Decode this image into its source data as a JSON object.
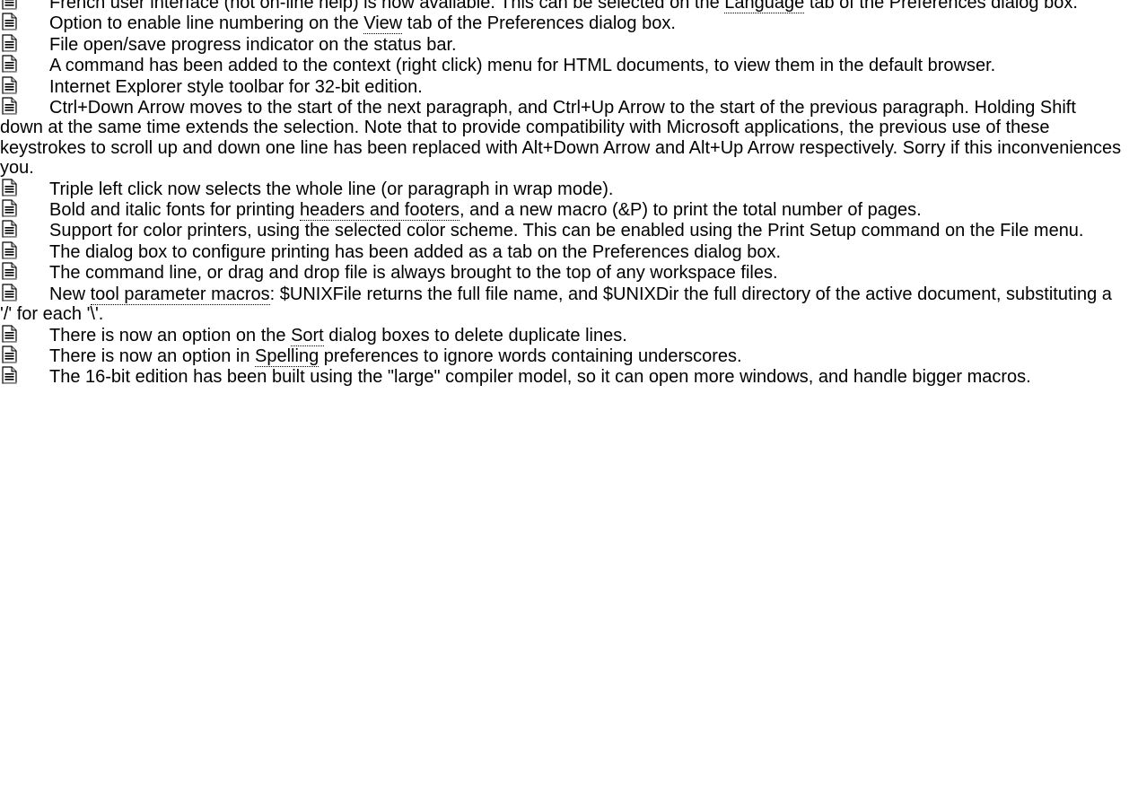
{
  "items": [
    {
      "parts": [
        {
          "t": "French user interface (not on-line help) is now available.   This can be selected on the "
        },
        {
          "t": "Language",
          "link": true
        },
        {
          "t": " tab of the Preferences dialog box."
        }
      ]
    },
    {
      "parts": [
        {
          "t": "Option to enable line numbering on the "
        },
        {
          "t": "View",
          "link": true
        },
        {
          "t": " tab of the Preferences dialog box."
        }
      ]
    },
    {
      "parts": [
        {
          "t": "File open/save progress indicator on the status bar."
        }
      ]
    },
    {
      "parts": [
        {
          "t": "A command has been added to the context (right click) menu for HTML documents, to view them in the default browser."
        }
      ]
    },
    {
      "parts": [
        {
          "t": "Internet Explorer style toolbar for 32-bit edition."
        }
      ]
    },
    {
      "parts": [
        {
          "t": "Ctrl+Down Arrow moves to the start of the next paragraph, and Ctrl+Up Arrow to the start of the previous paragraph.   Holding Shift down at the same time extends the selection.   Note that to provide compatibility with Microsoft applications, the previous use of these keystrokes to scroll up and down one line has been replaced with Alt+Down Arrow and Alt+Up Arrow respectively.   Sorry if this inconveniences you."
        }
      ]
    },
    {
      "parts": [
        {
          "t": "Triple left click now selects the whole line (or paragraph in wrap mode)."
        }
      ]
    },
    {
      "parts": [
        {
          "t": "Bold and italic fonts for printing "
        },
        {
          "t": "headers and footers",
          "link": true
        },
        {
          "t": ", and a new macro (&P) to print the total number of pages."
        }
      ]
    },
    {
      "parts": [
        {
          "t": "Support for color printers, using the selected color scheme.   This can be enabled using the Print Setup command on the File menu."
        }
      ]
    },
    {
      "parts": [
        {
          "t": "The dialog box to configure printing has been added as a tab on the Preferences dialog box."
        }
      ]
    },
    {
      "parts": [
        {
          "t": "The command line, or drag and drop file is always brought to the top of any workspace files."
        }
      ]
    },
    {
      "parts": [
        {
          "t": "New "
        },
        {
          "t": "tool parameter macros",
          "link": true
        },
        {
          "t": ": $UNIXFile returns the full file name, and $UNIXDir the full directory of the active document, substituting a '/' for each '\\'."
        }
      ]
    },
    {
      "parts": [
        {
          "t": "There is now an option on the "
        },
        {
          "t": "Sort",
          "link": true
        },
        {
          "t": " dialog boxes to delete duplicate lines."
        }
      ]
    },
    {
      "parts": [
        {
          "t": "There is now an option in "
        },
        {
          "t": "Spelling",
          "link": true
        },
        {
          "t": " preferences to ignore words containing underscores."
        }
      ]
    },
    {
      "parts": [
        {
          "t": "The 16-bit edition has been built using the \"large\" compiler model, so it can open more windows, and handle bigger macros."
        }
      ]
    }
  ],
  "bullet_icon": "document-icon"
}
